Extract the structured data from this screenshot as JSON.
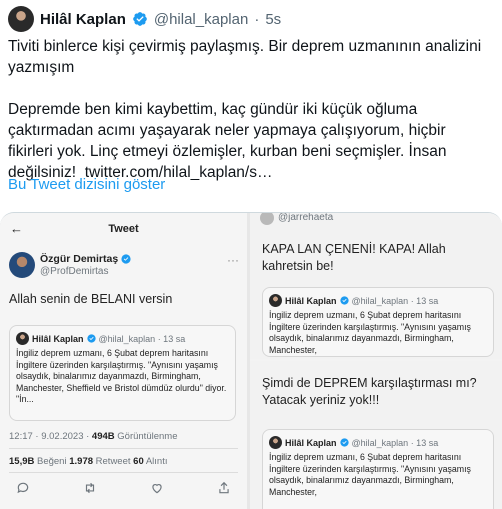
{
  "tweet": {
    "author_name": "Hilâl Kaplan",
    "handle": "@hilal_kaplan",
    "separator": "·",
    "time": "5s",
    "paragraph1": "Tiviti binlerce kişi çevirmiş paylaşmış. Bir deprem uzmanının analizini yazmışım",
    "paragraph2": "Depremde ben kimi kaybettim, kaç gündür iki küçük oğluma çaktırmadan acımı yaşayarak neler yapmaya çalışıyorum, hiçbir fikirleri yok. Linç etmeyi özlemişler, kurban beni seçmişler. İnsan değilsiniz!",
    "link_text": "twitter.com/hilal_kaplan/s…",
    "show_thread": "Bu Tweet dizisini göster"
  },
  "left_screenshot": {
    "back_arrow": "←",
    "nav_title": "Tweet",
    "author_name": "Özgür Demirtaş",
    "handle": "@ProfDemirtas",
    "more": "···",
    "text": "Allah senin de BELANI versin",
    "quote": {
      "name": "Hilâl Kaplan",
      "meta": "@hilal_kaplan · 13 sa",
      "body": "İngiliz deprem uzmanı, 6 Şubat deprem haritasını İngiltere üzerinden karşılaştırmış. \"Aynısını yaşamış olsaydık, binalarımız dayanmazdı, Birmingham, Manchester, Sheffield ve Bristol dümdüz olurdu\" diyor. \"İn..."
    },
    "meta_time": "12:17 · 9.02.2023 · ",
    "views_count": "494B",
    "views_label": " Görüntülenme",
    "likes_count": "15,9B",
    "likes_label": " Beğeni  ",
    "retweets_count": "1.978",
    "retweets_label": " Retweet  ",
    "quotes_count": "60",
    "quotes_label": " Alıntı"
  },
  "right_top": {
    "handle": "@jarrehaeta",
    "text": "KAPA LAN ÇENENİ! KAPA! Allah kahretsin be!",
    "quote": {
      "name": "Hilâl Kaplan",
      "meta": "@hilal_kaplan · 13 sa",
      "body": "İngiliz deprem uzmanı, 6 Şubat deprem haritasını İngiltere üzerinden karşılaştırmış. \"Aynısını yaşamış olsaydık, binalarımız dayanmazdı, Birmingham, Manchester,"
    }
  },
  "right_bottom": {
    "text": "Şimdi de DEPREM karşılaştırması mı? Yatacak yeriniz yok!!!",
    "quote": {
      "name": "Hilâl Kaplan",
      "meta": "@hilal_kaplan · 13 sa",
      "body": "İngiliz deprem uzmanı, 6 Şubat deprem haritasını İngiltere üzerinden karşılaştırmış. \"Aynısını yaşamış olsaydık, binalarımız dayanmazdı, Birmingham, Manchester,"
    }
  },
  "colors": {
    "accent": "#1d9bf0",
    "verified": "#1d9bf0",
    "text": "#0f1419",
    "muted": "#536471"
  },
  "icons": [
    "verified-badge-icon",
    "back-arrow-icon",
    "reply-icon",
    "retweet-icon",
    "like-icon",
    "share-icon",
    "more-icon"
  ]
}
